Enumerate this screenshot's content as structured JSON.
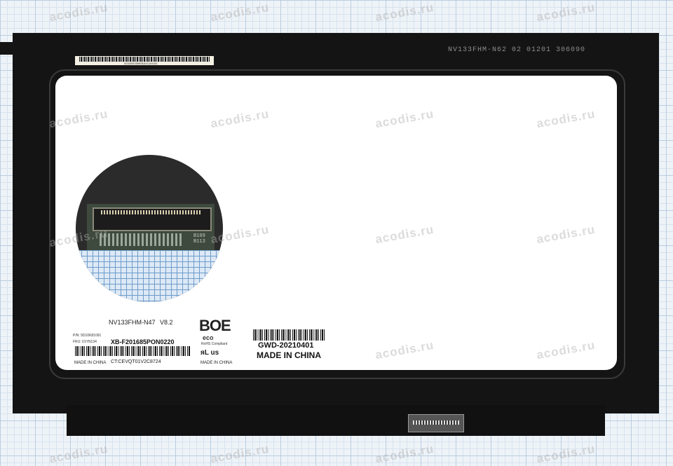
{
  "panel": {
    "reference_code": "NV133FHM-N62 02 01201 306090",
    "top_label_sub": "0033090399EBAXCA9100",
    "inset_board_ref": "B109\nB113",
    "model": "NV133FHM-N47",
    "version": "V8.2",
    "part_number": "P/N: 5D10K81091",
    "fru": "FRU: 01YN134",
    "serial": "XB-F201685PON0220",
    "made_in_left": "MADE IN CHINA",
    "ct_code": "CT:CEVQT01V2C8724",
    "brand": "BOE",
    "eco_mark": "eco",
    "rohs": "RoHS Compliant",
    "ul_mark": "ᴙL us",
    "made_in_mid": "MADE IN CHINA",
    "gwd_code": "GWD-20210401",
    "made_in_right": "MADE IN CHINA"
  },
  "watermark": {
    "text": "acodis.ru"
  },
  "colors": {
    "panel": "#141414",
    "screen": "#ffffff",
    "grid_paper": "#eef3f8"
  }
}
